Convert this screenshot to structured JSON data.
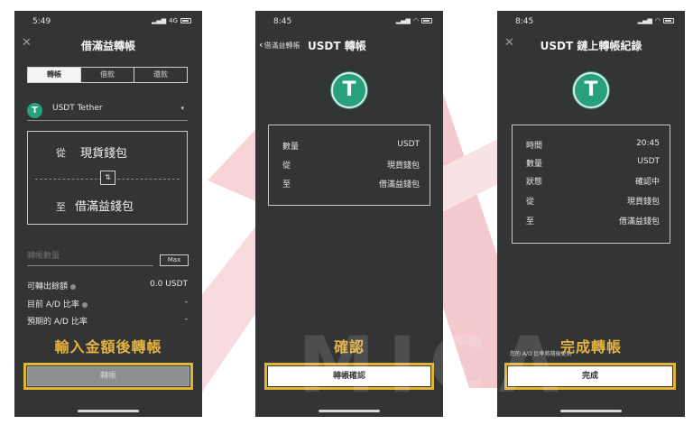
{
  "screen1": {
    "status": {
      "time": "5:49",
      "network": "4G"
    },
    "title": "借滿益轉帳",
    "close_icon": "close-icon",
    "tabs": [
      "轉帳",
      "借款",
      "還款"
    ],
    "coin": {
      "icon": "tether-icon",
      "name": "USDT Tether",
      "caret": "▾"
    },
    "from_label": "從",
    "from_value": "現貨錢包",
    "swap_icon": "⇅",
    "to_label": "至",
    "to_value": "借滿益錢包",
    "amount_placeholder": "轉帳數量",
    "max_label": "Max",
    "info": [
      {
        "label": "可轉出餘額",
        "value": "0.0 USDT"
      },
      {
        "label": "目前 A/D 比率",
        "value": "-"
      },
      {
        "label": "預期的 A/D 比率",
        "value": "-"
      }
    ],
    "caption": "輸入金額後轉帳",
    "button": "轉帳"
  },
  "screen2": {
    "status": {
      "time": "8:45"
    },
    "back_label": "借滿益轉帳",
    "title": "USDT 轉帳",
    "rows": [
      {
        "label": "數量",
        "value": "USDT"
      },
      {
        "label": "從",
        "value": "現貨錢包"
      },
      {
        "label": "至",
        "value": "借滿益錢包"
      }
    ],
    "caption": "確認",
    "button": "轉帳確認"
  },
  "screen3": {
    "status": {
      "time": "8:45"
    },
    "title": "USDT 鏈上轉帳紀錄",
    "rows": [
      {
        "label": "時間",
        "value": "20:45"
      },
      {
        "label": "數量",
        "value": "USDT"
      },
      {
        "label": "狀態",
        "value": "確認中"
      },
      {
        "label": "從",
        "value": "現貨錢包"
      },
      {
        "label": "至",
        "value": "借滿益錢包"
      }
    ],
    "hint": "您的 A/D 比率將隨後更新",
    "caption": "完成轉帳",
    "button": "完成"
  },
  "watermark": "MICA",
  "colors": {
    "phone_bg": "#333436",
    "highlight": "#e0b534",
    "caption": "#e3b341",
    "tether": "#26a17b",
    "disabled_button": "#8e8e8e",
    "logo_pink": "#f4c6cc"
  }
}
